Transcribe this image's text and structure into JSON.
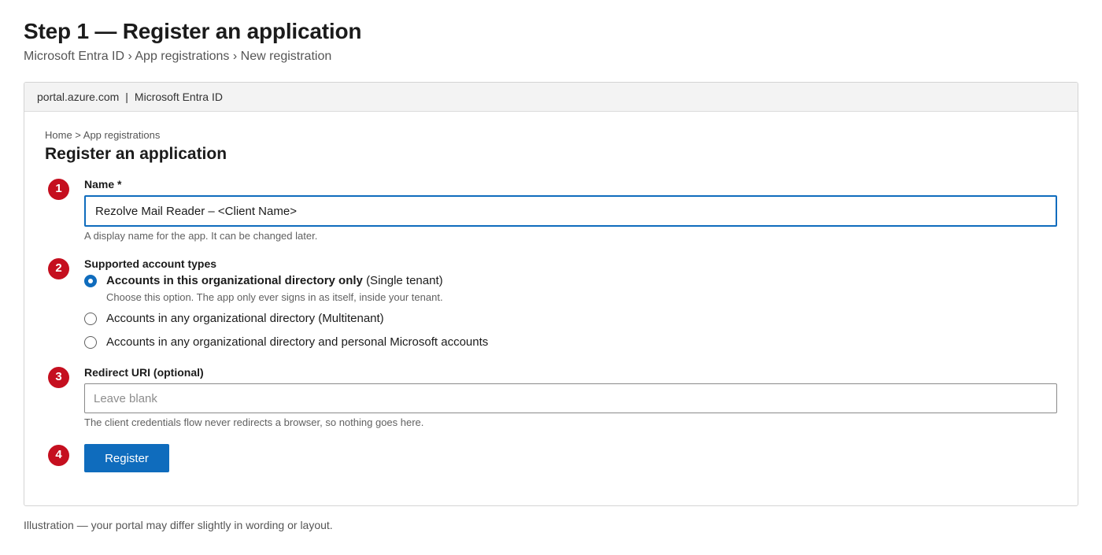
{
  "page": {
    "title": "Step 1 — Register an application",
    "breadcrumb": "Microsoft Entra ID › App registrations › New registration"
  },
  "window": {
    "url": "portal.azure.com",
    "separator": "|",
    "app": "Microsoft Entra ID"
  },
  "form": {
    "breadcrumb": "Home > App registrations",
    "title": "Register an application",
    "steps": [
      "1",
      "2",
      "3",
      "4"
    ],
    "name": {
      "label": "Name *",
      "value": "Rezolve Mail Reader – <Client Name>",
      "help": "A display name for the app. It can be changed later."
    },
    "account_types": {
      "label": "Supported account types",
      "options": [
        {
          "bold": "Accounts in this organizational directory only",
          "suffix": "(Single tenant)",
          "checked": true,
          "help": "Choose this option. The app only ever signs in as itself, inside your tenant."
        },
        {
          "text": "Accounts in any organizational directory (Multitenant)",
          "checked": false
        },
        {
          "text": "Accounts in any organizational directory and personal Microsoft accounts",
          "checked": false
        }
      ]
    },
    "redirect": {
      "label": "Redirect URI (optional)",
      "placeholder": "Leave blank",
      "value": "",
      "help": "The client credentials flow never redirects a browser, so nothing goes here."
    },
    "register_label": "Register"
  },
  "footnote": "Illustration — your portal may differ slightly in wording or layout.",
  "colors": {
    "accent": "#0f6cbd",
    "step_badge": "#c50f1f"
  }
}
